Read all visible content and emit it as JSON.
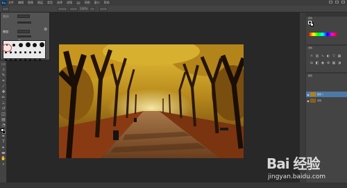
{
  "menubar": {
    "logo": "Ps",
    "items": [
      "文件",
      "编辑",
      "图像",
      "图层",
      "类型",
      "选择",
      "滤镜",
      "3D",
      "视图",
      "窗口",
      "帮助"
    ]
  },
  "options_bar": {
    "zoom": "100%"
  },
  "brush_panel": {
    "size_label": "大小:",
    "size_value": "",
    "hardness_label": "硬度:",
    "hardness_value": "0%"
  },
  "right_panels": {
    "color_title": "颜色",
    "adjustments_title": "调整",
    "layers_title": "图层",
    "layers": [
      {
        "name": "图层 1",
        "selected": true
      },
      {
        "name": "背景",
        "selected": false
      }
    ]
  },
  "status_bar": {
    "text": ""
  },
  "watermark": {
    "logo": "Bai 经验",
    "url": "jingyan.baidu.com"
  },
  "colors": {
    "selection_ring": "#e83a3a",
    "layer_selected": "#4d79a8"
  }
}
